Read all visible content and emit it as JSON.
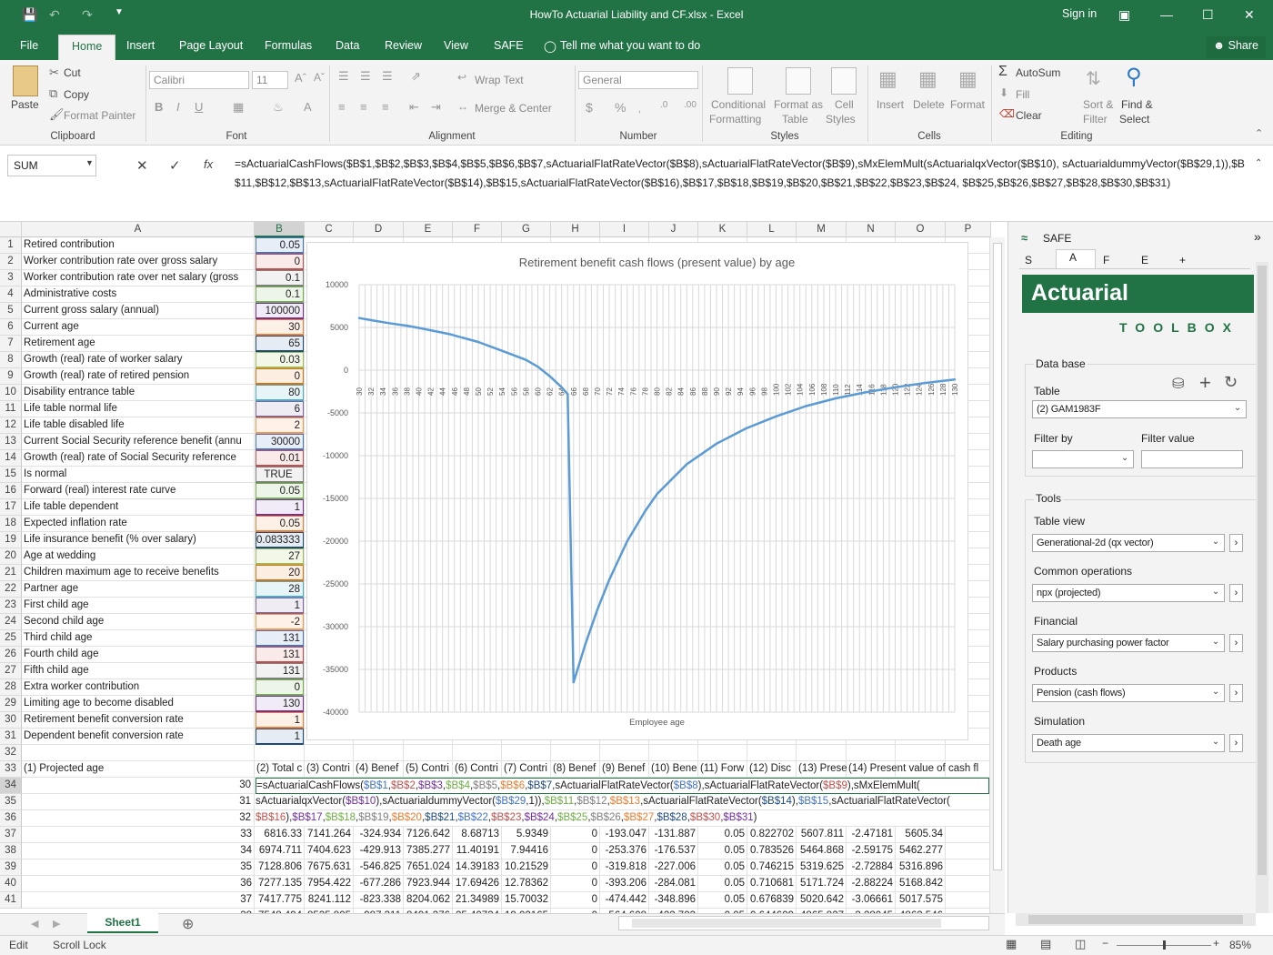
{
  "window": {
    "title": "HowTo Actuarial Liability and CF.xlsx - Excel",
    "signin": "Sign in",
    "share": "Share"
  },
  "tabs": [
    "File",
    "Home",
    "Insert",
    "Page Layout",
    "Formulas",
    "Data",
    "Review",
    "View",
    "SAFE"
  ],
  "tell_me": "Tell me what you want to do",
  "ribbon": {
    "clipboard": {
      "paste": "Paste",
      "cut": "Cut",
      "copy": "Copy",
      "format_painter": "Format Painter",
      "group": "Clipboard"
    },
    "font": {
      "name": "Calibri",
      "size": "11",
      "group": "Font"
    },
    "alignment": {
      "wrap": "Wrap Text",
      "merge": "Merge & Center",
      "group": "Alignment"
    },
    "number": {
      "format": "General",
      "group": "Number"
    },
    "styles": {
      "conditional": "Conditional",
      "formatting": "Formatting",
      "format_as": "Format as",
      "table": "Table",
      "cell": "Cell",
      "cell_styles": "Styles",
      "group": "Styles"
    },
    "cells": {
      "insert": "Insert",
      "delete": "Delete",
      "format": "Format",
      "group": "Cells"
    },
    "editing": {
      "autosum": "AutoSum",
      "fill": "Fill",
      "clear": "Clear",
      "sort": "Sort &",
      "filter": "Filter",
      "find": "Find &",
      "select": "Select",
      "group": "Editing"
    }
  },
  "namebox": "SUM",
  "formula": "=sActuarialCashFlows($B$1,$B$2,$B$3,$B$4,$B$5,$B$6,$B$7,sActuarialFlatRateVector($B$8),sActuarialFlatRateVector($B$9),sMxElemMult(sActuarialqxVector($B$10), sActuarialdummyVector($B$29,1)),$B$11,$B$12,$B$13,sActuarialFlatRateVector($B$14),$B$15,sActuarialFlatRateVector($B$16),$B$17,$B$18,$B$19,$B$20,$B$21,$B$22,$B$23,$B$24, $B$25,$B$26,$B$27,$B$28,$B$30,$B$31)",
  "columns": [
    "A",
    "B",
    "C",
    "D",
    "E",
    "F",
    "G",
    "H",
    "I",
    "J",
    "K",
    "L",
    "M",
    "N",
    "O",
    "P"
  ],
  "params": [
    [
      "Retired contribution",
      "0.05"
    ],
    [
      "Worker contribution rate over gross salary",
      "0"
    ],
    [
      "Worker contribution rate over net salary (gross",
      "0.1"
    ],
    [
      "Administrative costs",
      "0.1"
    ],
    [
      "Current gross salary (annual)",
      "100000"
    ],
    [
      "Current age",
      "30"
    ],
    [
      "Retirement age",
      "65"
    ],
    [
      "Growth (real) rate of worker salary",
      "0.03"
    ],
    [
      "Growth (real) rate of retired pension",
      "0"
    ],
    [
      "Disability entrance table",
      "80"
    ],
    [
      "Life table normal life",
      "6"
    ],
    [
      "Life table disabled life",
      "2"
    ],
    [
      "Current Social Security reference benefit (annu",
      "30000"
    ],
    [
      "Growth (real) rate of Social Security reference",
      "0.01"
    ],
    [
      "Is normal",
      "TRUE"
    ],
    [
      "Forward (real) interest rate curve",
      "0.05"
    ],
    [
      "Life table dependent",
      "1"
    ],
    [
      "Expected inflation rate",
      "0.05"
    ],
    [
      "Life insurance benefit (% over salary)",
      "0.083333"
    ],
    [
      "Age at wedding",
      "27"
    ],
    [
      "Children maximum age to receive benefits",
      "20"
    ],
    [
      "Partner age",
      "28"
    ],
    [
      "First child age",
      "1"
    ],
    [
      "Second child age",
      "-2"
    ],
    [
      "Third child age",
      "131"
    ],
    [
      "Fourth child age",
      "131"
    ],
    [
      "Fifth child age",
      "131"
    ],
    [
      "Extra worker contribution",
      "0"
    ],
    [
      "Limiting age to become disabled",
      "130"
    ],
    [
      "Retirement benefit conversion rate",
      "1"
    ],
    [
      "Dependent benefit conversion rate",
      "1"
    ]
  ],
  "row33": [
    "(1) Projected age",
    "(2) Total c",
    "(3) Contri",
    "(4) Benef",
    "(5) Contri",
    "(6) Contri",
    "(7) Contri",
    "(8) Benef",
    "(9) Benef",
    "(10) Bene",
    "(11) Forw",
    "(12) Disc",
    "(13) Prese",
    "(14) Present value of cash fl"
  ],
  "edit_rows": [
    {
      "age": "30",
      "text": "=sActuarialCashFlows($B$1,$B$2,$B$3,$B$4,$B$5,$B$6,$B$7,sActuarialFlatRateVector($B$8),sActuarialFlatRateVector($B$9),sMxElemMult("
    },
    {
      "age": "31",
      "text": "sActuarialqxVector($B$10),sActuarialdummyVector($B$29,1)),$B$11,$B$12,$B$13,sActuarialFlatRateVector($B$14),$B$15,sActuarialFlatRateVector("
    },
    {
      "age": "32",
      "text": "$B$16),$B$17,$B$18,$B$19,$B$20,$B$21,$B$22,$B$23,$B$24,$B$25,$B$26,$B$27,$B$28,$B$30,$B$31)"
    }
  ],
  "data_rows": [
    [
      "33",
      "6816.33",
      "7141.264",
      "-324.934",
      "7126.642",
      "8.68713",
      "5.9349",
      "0",
      "-193.047",
      "-131.887",
      "0.05",
      "0.822702",
      "5607.811",
      "-2.47181",
      "5605.34"
    ],
    [
      "34",
      "6974.711",
      "7404.623",
      "-429.913",
      "7385.277",
      "11.40191",
      "7.94416",
      "0",
      "-253.376",
      "-176.537",
      "0.05",
      "0.783526",
      "5464.868",
      "-2.59175",
      "5462.277"
    ],
    [
      "35",
      "7128.806",
      "7675.631",
      "-546.825",
      "7651.024",
      "14.39183",
      "10.21529",
      "0",
      "-319.818",
      "-227.006",
      "0.05",
      "0.746215",
      "5319.625",
      "-2.72884",
      "5316.896"
    ],
    [
      "36",
      "7277.135",
      "7954.422",
      "-677.286",
      "7923.944",
      "17.69426",
      "12.78362",
      "0",
      "-393.206",
      "-284.081",
      "0.05",
      "0.710681",
      "5171.724",
      "-2.88224",
      "5168.842"
    ],
    [
      "37",
      "7417.775",
      "8241.112",
      "-823.338",
      "8204.062",
      "21.34989",
      "15.70032",
      "0",
      "-474.442",
      "-348.896",
      "0.05",
      "0.676839",
      "5020.642",
      "-3.06661",
      "5017.575"
    ],
    [
      "38",
      "7548.494",
      "8535.805",
      "-987.311",
      "8491.376",
      "25.40734",
      "19.02165",
      "0",
      "-564.608",
      "-422.703",
      "0.05",
      "0.644609",
      "4865.827",
      "-3.28045",
      "4862.546"
    ]
  ],
  "chart_data": {
    "type": "line",
    "title": "Retirement benefit cash flows (present value) by age",
    "xlabel": "Employee age",
    "ylabel": "",
    "ylim": [
      -40000,
      10000
    ],
    "yticks": [
      10000,
      5000,
      0,
      -5000,
      -10000,
      -15000,
      -20000,
      -25000,
      -30000,
      -35000,
      -40000
    ],
    "grid": true,
    "series": [
      {
        "color": "#5b9bd5",
        "x": [
          30,
          32,
          35,
          38,
          40,
          45,
          50,
          55,
          58,
          60,
          62,
          64,
          65,
          66,
          68,
          70,
          72,
          75,
          78,
          80,
          85,
          90,
          95,
          100,
          105,
          110,
          115,
          120,
          125,
          130
        ],
        "values": [
          6100,
          5850,
          5500,
          5200,
          4950,
          4250,
          3300,
          2000,
          1200,
          400,
          -700,
          -2000,
          -2800,
          -36500,
          -32000,
          -28000,
          -24500,
          -20000,
          -16500,
          -14500,
          -11000,
          -8600,
          -6800,
          -5400,
          -4200,
          -3300,
          -2600,
          -2000,
          -1500,
          -1100
        ]
      }
    ],
    "xticks_start": 30,
    "xticks_end": 130
  },
  "panel": {
    "title": "SAFE",
    "tabs": [
      "S",
      "A",
      "F",
      "E",
      "+"
    ],
    "banner": "Actuarial",
    "toolbox": "TOOLBOX",
    "data_base": "Data base",
    "table_label": "Table",
    "table_value": "(2) GAM1983F",
    "filter_by": "Filter by",
    "filter_value": "Filter value",
    "tools": "Tools",
    "table_view": "Table view",
    "table_view_value": "Generational-2d (qx vector)",
    "common_ops": "Common operations",
    "common_ops_value": "npx (projected)",
    "financial": "Financial",
    "financial_value": "Salary purchasing power factor",
    "products": "Products",
    "products_value": "Pension (cash flows)",
    "simulation": "Simulation",
    "simulation_value": "Death age"
  },
  "sheet": "Sheet1",
  "status": {
    "mode": "Edit",
    "scroll": "Scroll Lock",
    "zoom": "85%"
  }
}
